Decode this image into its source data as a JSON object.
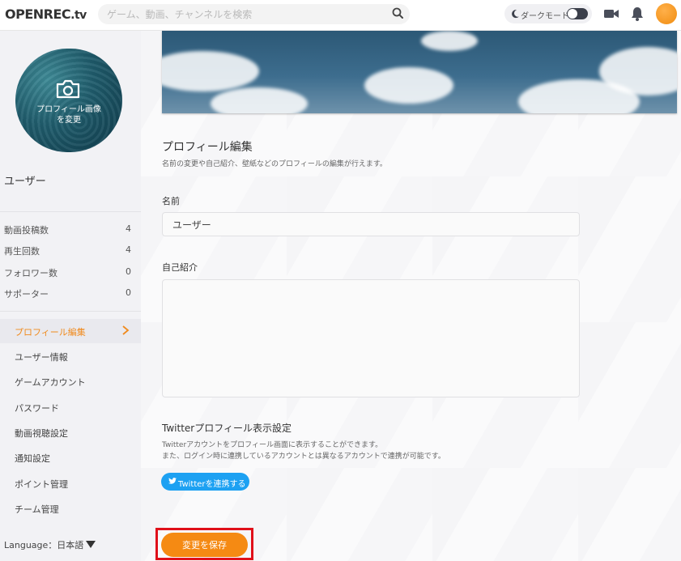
{
  "header": {
    "logo_main": "OPENREC",
    "logo_suffix": ".tv",
    "search_placeholder": "ゲーム、動画、チャンネルを検索",
    "dark_mode_label": "ダークモード",
    "dark_mode_on": false
  },
  "sidebar": {
    "profile_image_label_line1": "プロフィール画像",
    "profile_image_label_line2": "を変更",
    "username": "ユーザー",
    "stats": [
      {
        "label": "動画投稿数",
        "value": "4"
      },
      {
        "label": "再生回数",
        "value": "4"
      },
      {
        "label": "フォロワー数",
        "value": "0"
      },
      {
        "label": "サポーター",
        "value": "0"
      }
    ],
    "menu": [
      {
        "label": "プロフィール編集",
        "active": true
      },
      {
        "label": "ユーザー情報",
        "active": false
      },
      {
        "label": "ゲームアカウント",
        "active": false
      },
      {
        "label": "パスワード",
        "active": false
      },
      {
        "label": "動画視聴設定",
        "active": false
      },
      {
        "label": "通知設定",
        "active": false
      },
      {
        "label": "ポイント管理",
        "active": false
      },
      {
        "label": "チーム管理",
        "active": false
      }
    ],
    "language": "Language：日本語"
  },
  "main": {
    "title": "プロフィール編集",
    "description": "名前の変更や自己紹介、壁紙などのプロフィールの編集が行えます。",
    "name_label": "名前",
    "name_value": "ユーザー",
    "bio_label": "自己紹介",
    "bio_value": "",
    "twitter_title": "Twitterプロフィール表示設定",
    "twitter_desc_line1": "Twitterアカウントをプロフィール画面に表示することができます。",
    "twitter_desc_line2": "また、ログイン時に連携しているアカウントとは異なるアカウントで連携が可能です。",
    "twitter_button": "Twitterを連携する",
    "save_button": "変更を保存"
  },
  "colors": {
    "accent": "#f58a13",
    "twitter": "#1da1f2",
    "highlight": "#e0101a"
  }
}
